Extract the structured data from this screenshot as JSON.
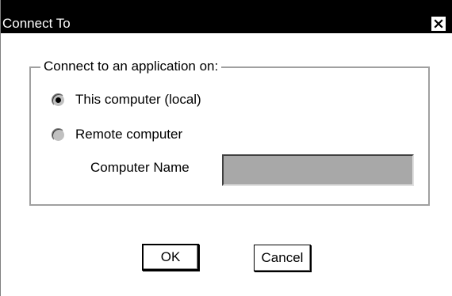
{
  "window": {
    "title": "Connect To",
    "close_glyph": "✕"
  },
  "group": {
    "legend": "Connect to an application on:",
    "options": [
      {
        "label": "This computer (local)",
        "selected": true
      },
      {
        "label": "Remote computer",
        "selected": false
      }
    ],
    "computer_name": {
      "label": "Computer Name",
      "value": ""
    }
  },
  "buttons": {
    "ok": "OK",
    "cancel": "Cancel"
  },
  "icons": {
    "close": "close-icon"
  },
  "colors": {
    "titlebar": "#000000",
    "title_text": "#ffffff",
    "input_disabled_bg": "#a8a8a8",
    "window_bg": "#ffffff"
  }
}
